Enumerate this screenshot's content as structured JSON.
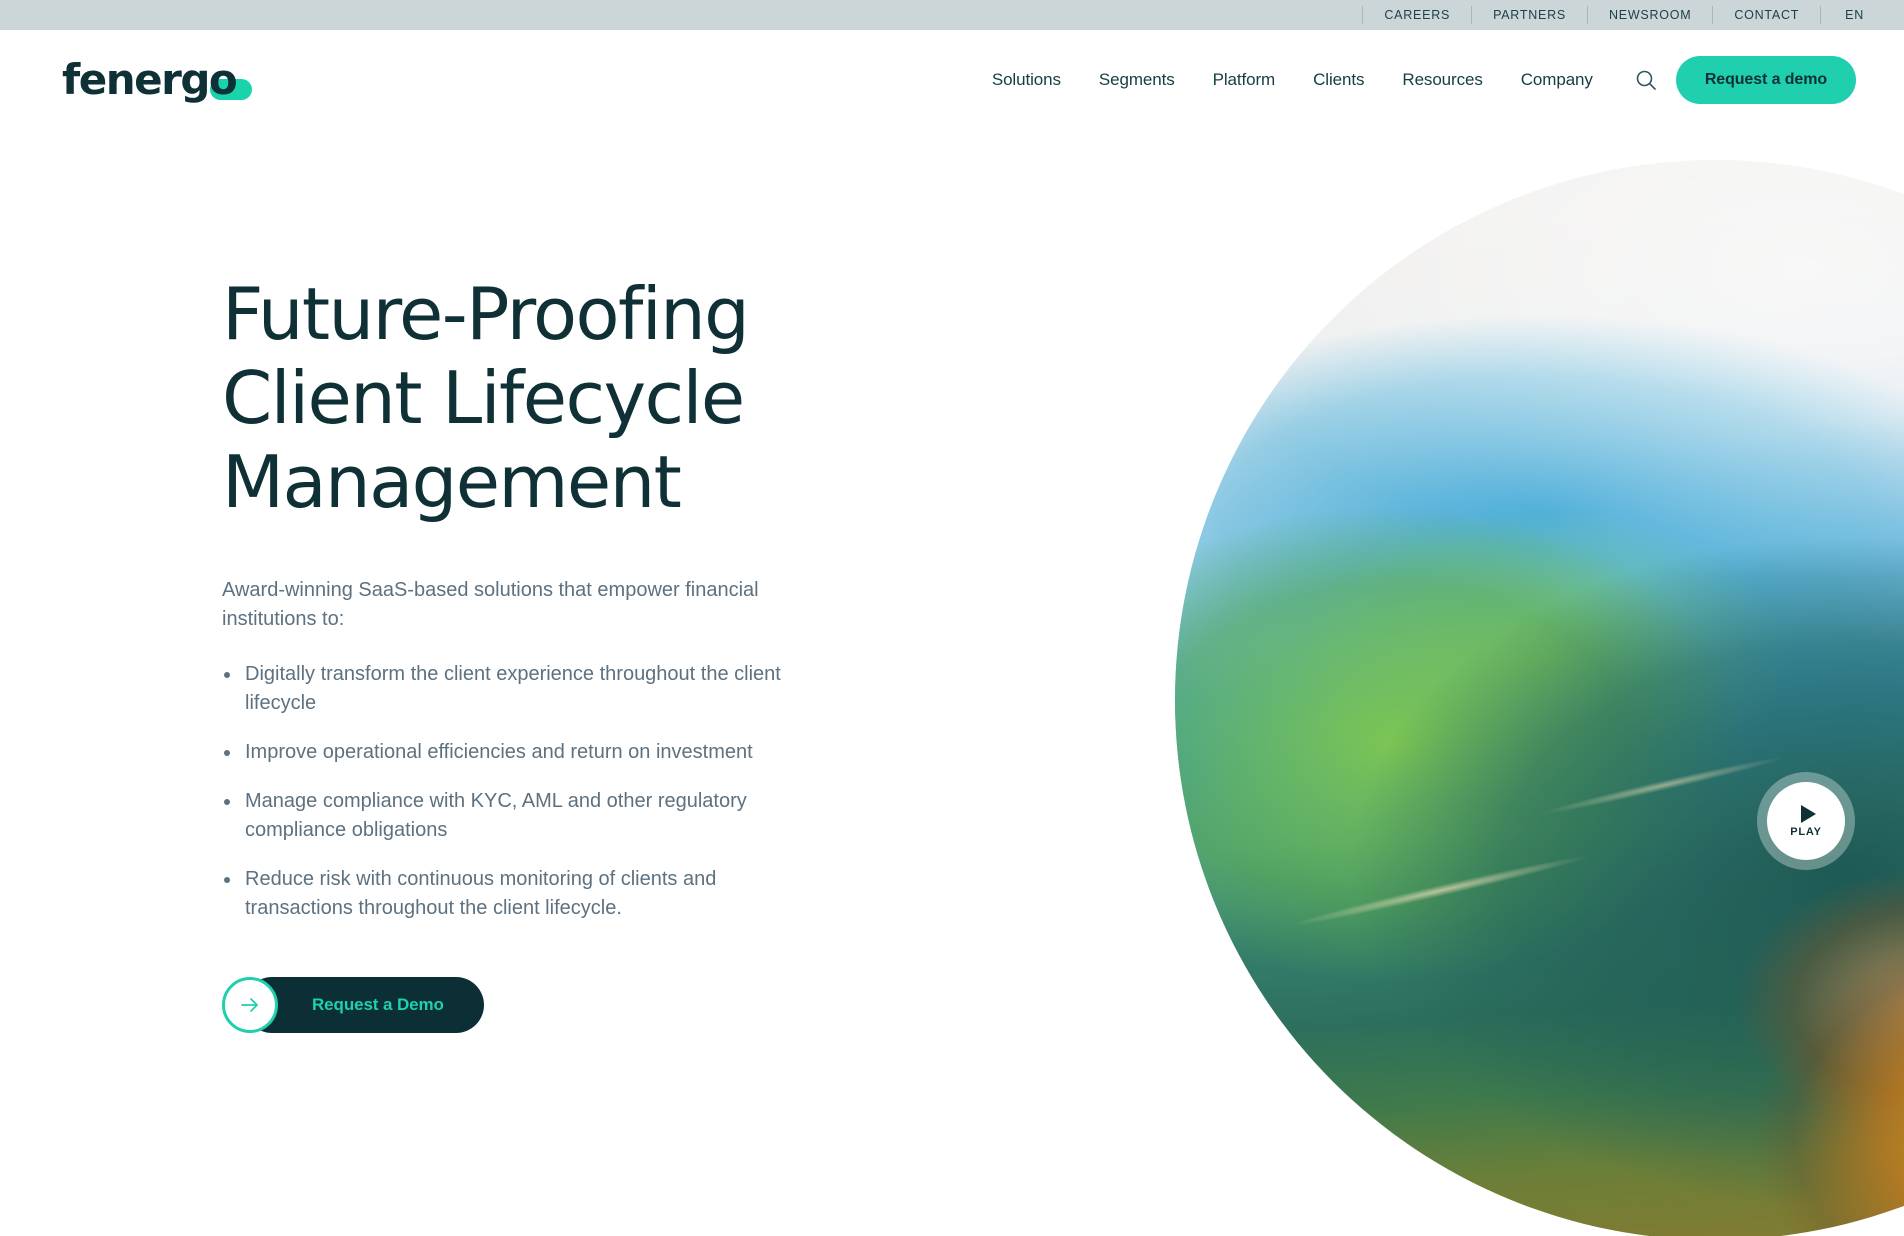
{
  "utility_nav": {
    "items": [
      {
        "label": "CAREERS"
      },
      {
        "label": "PARTNERS"
      },
      {
        "label": "NEWSROOM"
      },
      {
        "label": "CONTACT"
      }
    ],
    "language": "EN"
  },
  "header": {
    "logo_text": "fenergo",
    "nav_items": [
      {
        "label": "Solutions"
      },
      {
        "label": "Segments"
      },
      {
        "label": "Platform"
      },
      {
        "label": "Clients"
      },
      {
        "label": "Resources"
      },
      {
        "label": "Company"
      }
    ],
    "search_icon": "search-icon",
    "demo_button_label": "Request a demo"
  },
  "hero": {
    "title": "Future-Proofing\nClient Lifecycle\nManagement",
    "lead": "Award-winning SaaS-based solutions that empower financial institutions to:",
    "bullets": [
      {
        "text": "Digitally transform the client experience throughout the client lifecycle"
      },
      {
        "text": "Improve operational efficiencies and return on investment"
      },
      {
        "text": "Manage compliance with KYC, AML and other regulatory compliance obligations"
      },
      {
        "text": "Reduce risk with continuous monitoring of clients and transactions throughout the client lifecycle."
      }
    ],
    "cta_label": "Request a Demo",
    "cta_icon": "arrow-right-icon",
    "play_label": "PLAY",
    "play_icon": "play-triangle-icon"
  },
  "colors": {
    "accent_teal": "#1fcfad",
    "dark_navy": "#0f3136",
    "utility_bar_bg": "#ccd5d7",
    "body_text": "#5d7180",
    "cta_pill_bg": "#0b2f34"
  }
}
